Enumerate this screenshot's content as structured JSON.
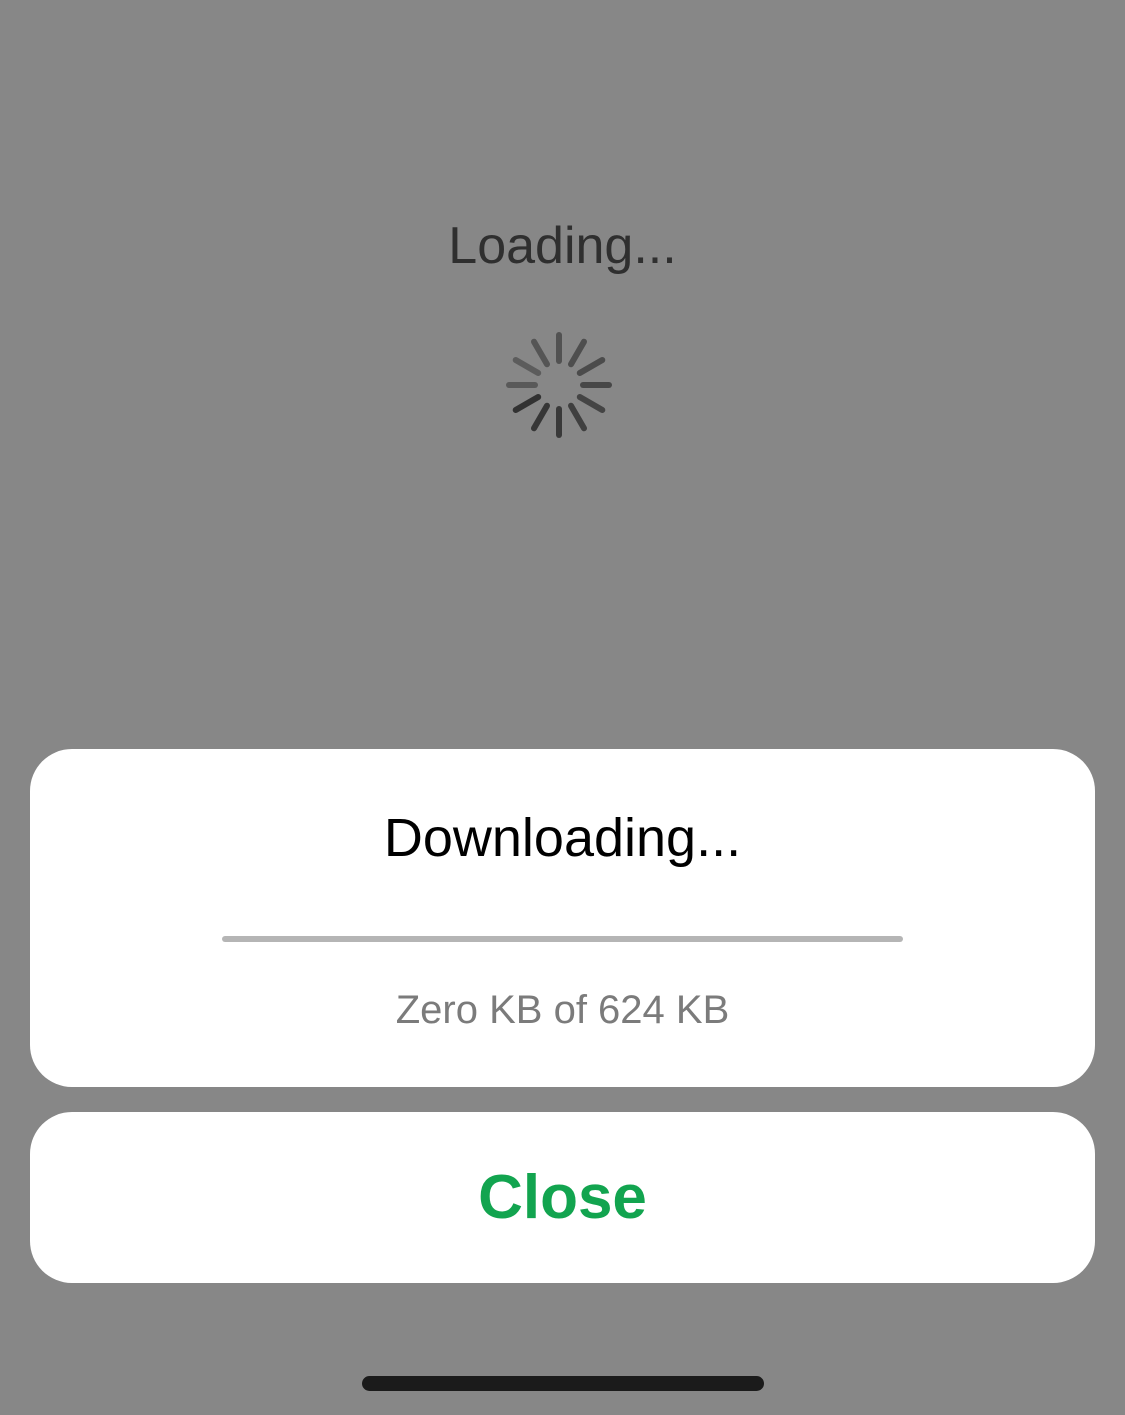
{
  "background": {
    "loading_text": "Loading...",
    "spinner_icon": "activity-spinner-icon",
    "overlay_color": "#878787"
  },
  "download_sheet": {
    "title": "Downloading...",
    "progress_fraction": 0,
    "progress_text": "Zero KB of 624 KB",
    "track_color": "#b5b5b5"
  },
  "close_button": {
    "label": "Close",
    "color": "#12a44f"
  },
  "home_indicator": {
    "icon": "home-indicator-bar"
  }
}
